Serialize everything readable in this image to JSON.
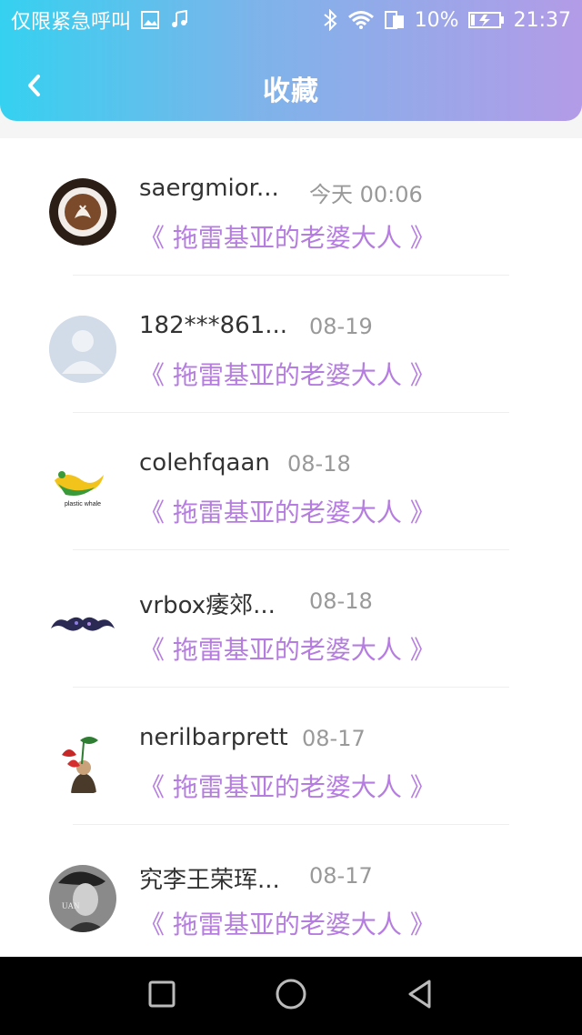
{
  "status": {
    "carrier": "仅限紧急呼叫",
    "battery": "10%",
    "time": "21:37"
  },
  "header": {
    "title": "收藏"
  },
  "colors": {
    "accent_gradient": [
      "#35d1f0",
      "#b39be7"
    ],
    "book_title": "#b67de0"
  },
  "items": [
    {
      "name": "saergmior...",
      "time": "今天 00:06",
      "book": "《 拖雷基亚的老婆大人 》",
      "avatar": "coffee-avatar-icon"
    },
    {
      "name": "182***861...",
      "time": "08-19",
      "book": "《 拖雷基亚的老婆大人 》",
      "avatar": "default-user-avatar-icon"
    },
    {
      "name": "colehfqaan",
      "time": "08-18",
      "book": "《 拖雷基亚的老婆大人 》",
      "avatar": "plastic-whale-logo-icon",
      "avatar_text": "plastic whale"
    },
    {
      "name": "vrbox痿郊...",
      "time": "08-18",
      "book": "《 拖雷基亚的老婆大人 》",
      "avatar": "mustache-avatar-icon"
    },
    {
      "name": "nerilbarprett",
      "time": "08-17",
      "book": "《 拖雷基亚的老婆大人 》",
      "avatar": "flower-figure-avatar-icon"
    },
    {
      "name": "究李王荣珲...",
      "time": "08-17",
      "book": "《 拖雷基亚的老婆大人 》",
      "avatar": "portrait-avatar-icon",
      "avatar_text": "UAN"
    }
  ],
  "navbar": {
    "buttons": [
      "recent-apps",
      "home",
      "back"
    ]
  }
}
